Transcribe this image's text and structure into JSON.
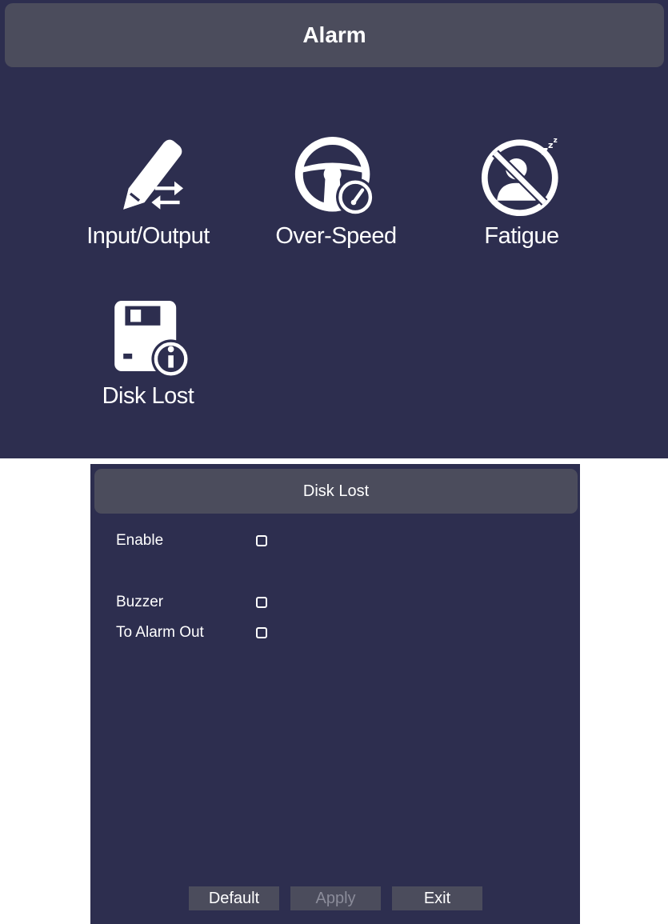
{
  "alarm": {
    "title": "Alarm",
    "tiles": [
      {
        "label": "Input/Output",
        "icon": "pencil-arrows-icon"
      },
      {
        "label": "Over-Speed",
        "icon": "steering-speedometer-icon"
      },
      {
        "label": "Fatigue",
        "icon": "no-sleep-driver-icon"
      },
      {
        "label": "Disk Lost",
        "icon": "floppy-disk-info-icon"
      }
    ]
  },
  "dialog": {
    "title": "Disk Lost",
    "rows": [
      {
        "label": "Enable",
        "checked": false
      },
      {
        "label": "Buzzer",
        "checked": false
      },
      {
        "label": "To Alarm Out",
        "checked": false
      }
    ],
    "buttons": {
      "default": "Default",
      "apply": "Apply",
      "exit": "Exit"
    }
  },
  "colors": {
    "panel_bg": "#2d2e4f",
    "header_bg": "#4b4c5c",
    "text": "#ffffff",
    "disabled_text": "#8b8c9a"
  }
}
